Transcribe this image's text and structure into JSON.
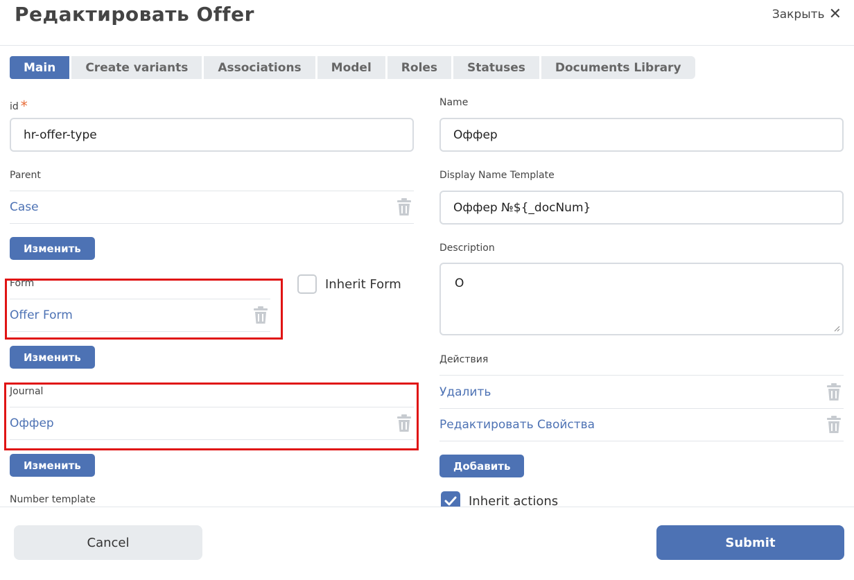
{
  "header": {
    "title": "Редактировать Offer",
    "close_label": "Закрыть"
  },
  "tabs": [
    {
      "label": "Main",
      "active": true
    },
    {
      "label": "Create variants"
    },
    {
      "label": "Associations"
    },
    {
      "label": "Model"
    },
    {
      "label": "Roles"
    },
    {
      "label": "Statuses"
    },
    {
      "label": "Documents Library"
    }
  ],
  "left": {
    "id": {
      "label": "id",
      "required_mark": "*",
      "value": "hr-offer-type"
    },
    "parent": {
      "label": "Parent",
      "value": "Case",
      "change_label": "Изменить"
    },
    "form": {
      "label": "Form",
      "value": "Offer Form",
      "change_label": "Изменить",
      "inherit_label": "Inherit Form",
      "inherit_checked": false
    },
    "journal": {
      "label": "Journal",
      "value": "Оффер",
      "change_label": "Изменить"
    },
    "number_template": {
      "label": "Number template"
    }
  },
  "right": {
    "name": {
      "label": "Name",
      "value": "Оффер"
    },
    "display_name_template": {
      "label": "Display Name Template",
      "value": "Оффер №${_docNum}"
    },
    "description": {
      "label": "Description",
      "value": "О"
    },
    "actions": {
      "label": "Действия",
      "items": [
        "Удалить",
        "Редактировать Свойства"
      ],
      "add_label": "Добавить",
      "inherit_label": "Inherit actions",
      "inherit_checked": true
    }
  },
  "footer": {
    "cancel_label": "Cancel",
    "submit_label": "Submit"
  },
  "colors": {
    "accent": "#4d72b4",
    "highlight": "#e01414",
    "required": "#e86e3a"
  }
}
